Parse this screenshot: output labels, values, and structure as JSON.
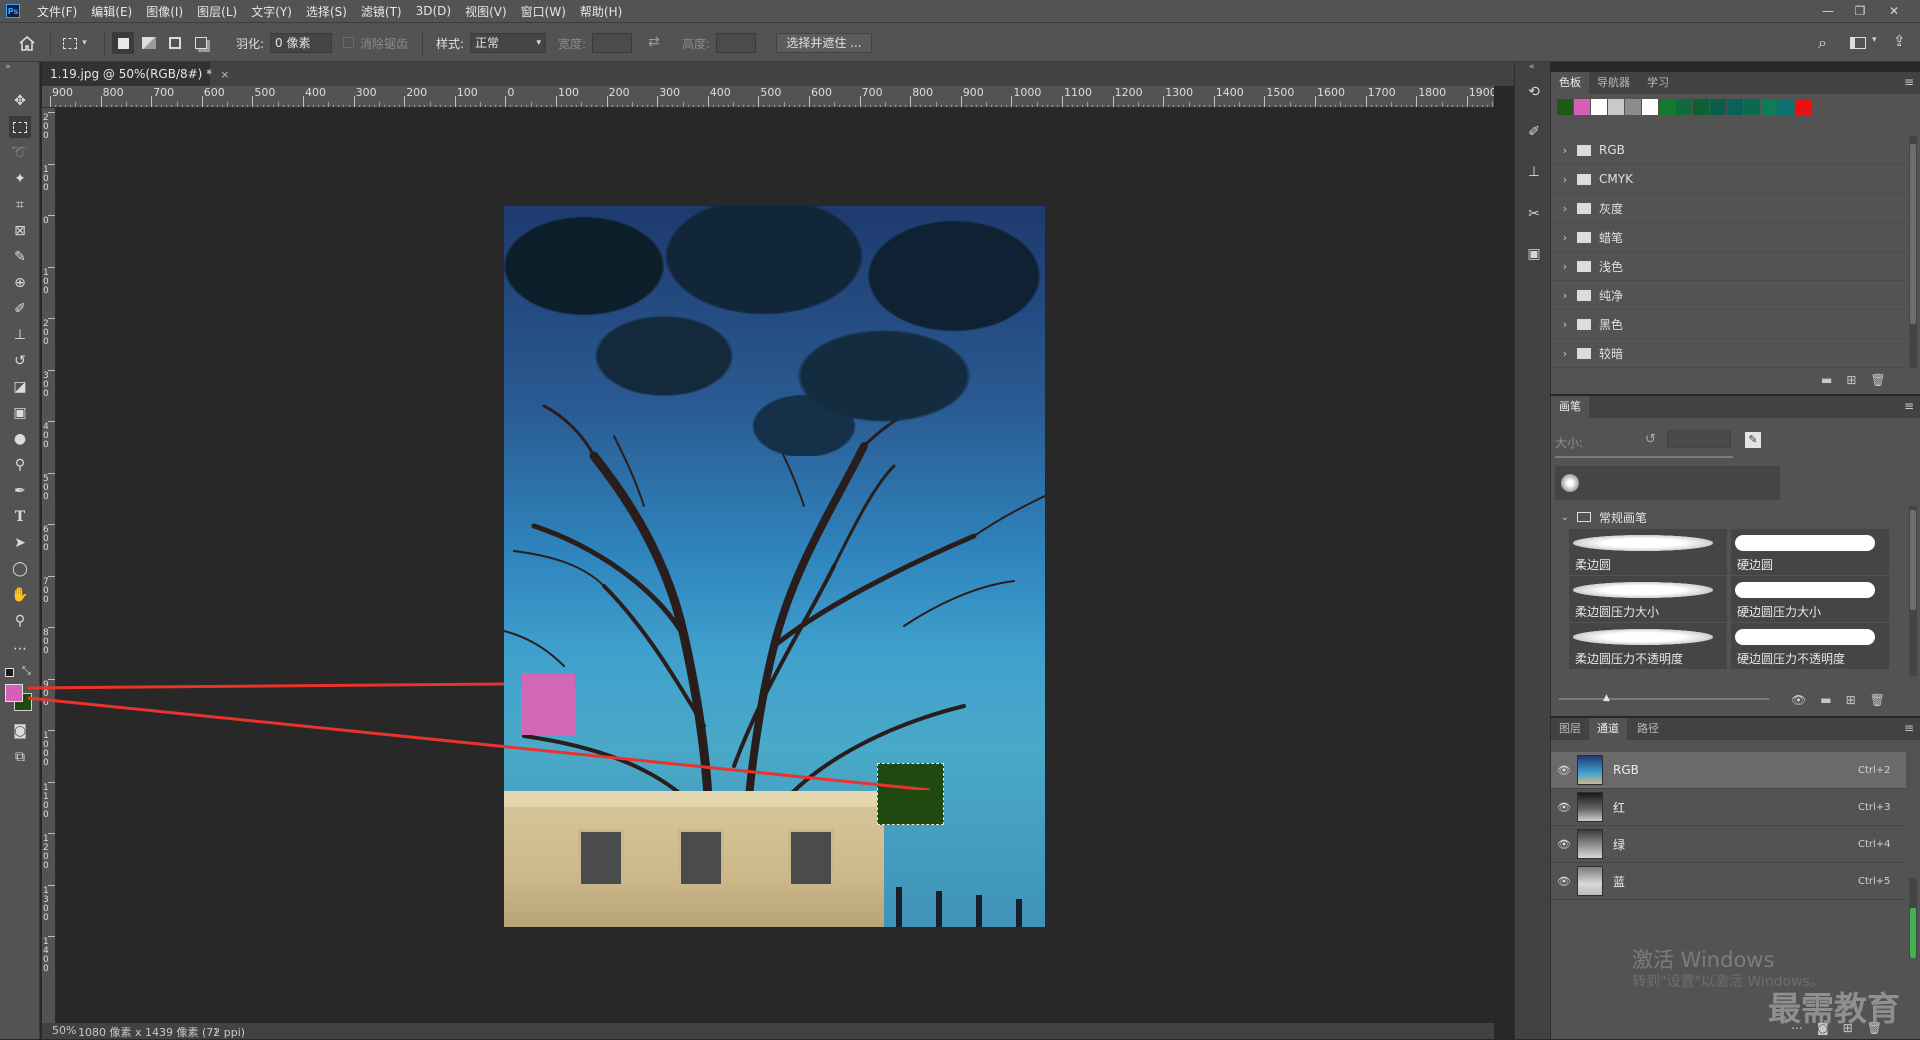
{
  "menubar": {
    "logo": "Ps",
    "items": [
      "文件(F)",
      "编辑(E)",
      "图像(I)",
      "图层(L)",
      "文字(Y)",
      "选择(S)",
      "滤镜(T)",
      "3D(D)",
      "视图(V)",
      "窗口(W)",
      "帮助(H)"
    ],
    "window_controls": [
      "—",
      "❐",
      "✕"
    ]
  },
  "options_bar": {
    "feather_label": "羽化:",
    "feather_value": "0 像素",
    "antialias_label": "消除锯齿",
    "style_label": "样式:",
    "style_value": "正常",
    "width_label": "宽度:",
    "height_label": "高度:",
    "select_mask_button": "选择并遮住 ..."
  },
  "document": {
    "tab_title": "1.19.jpg @ 50%(RGB/8#) *",
    "close_glyph": "×"
  },
  "ruler": {
    "h_labels": [
      "900",
      "800",
      "700",
      "600",
      "500",
      "400",
      "300",
      "200",
      "100",
      "0",
      "100",
      "200",
      "300",
      "400",
      "500",
      "600",
      "700",
      "800",
      "900",
      "1000",
      "1100",
      "1200",
      "1300",
      "1400",
      "1500",
      "1600",
      "1700",
      "1800",
      "1900"
    ],
    "v_labels": [
      "2\n0\n0",
      "1\n0\n0",
      "0",
      "1\n0\n0",
      "2\n0\n0",
      "3\n0\n0",
      "4\n0\n0",
      "5\n0\n0",
      "6\n0\n0",
      "7\n0\n0",
      "8\n0\n0",
      "9\n0\n0",
      "1\n0\n0\n0",
      "1\n1\n0\n0",
      "1\n2\n0\n0",
      "1\n3\n0\n0",
      "1\n4\n0\n0"
    ]
  },
  "colors": {
    "foreground": "#d560b5",
    "background": "#1e4a12",
    "pink_swatch": "#d067b7",
    "green_selection": "#1e4a12",
    "red_arrow": "#e8342c"
  },
  "swatches_panel": {
    "tabs": [
      "色板",
      "导航器",
      "学习"
    ],
    "recent": [
      "#1d5a1a",
      "#d560b5",
      "#ffffff",
      "#c9c9c9",
      "#8c8c8c",
      "#ffffff",
      "#117a2b",
      "#0f6b3a",
      "#0e5f33",
      "#0d5b4a",
      "#0c6055",
      "#0b6a4d",
      "#117a57",
      "#0f7070",
      "#e81010"
    ],
    "groups": [
      "RGB",
      "CMYK",
      "灰度",
      "蜡笔",
      "浅色",
      "纯净",
      "黑色",
      "较暗"
    ]
  },
  "brush_panel": {
    "tab": "画笔",
    "size_label": "大小:",
    "group_name": "常规画笔",
    "brushes": [
      "柔边圆",
      "硬边圆",
      "柔边圆压力大小",
      "硬边圆压力大小",
      "柔边圆压力不透明度",
      "硬边圆压力不透明度"
    ]
  },
  "channels_panel": {
    "tabs": [
      "图层",
      "通道",
      "路径"
    ],
    "channels": [
      {
        "name": "RGB",
        "shortcut": "Ctrl+2"
      },
      {
        "name": "红",
        "shortcut": "Ctrl+3"
      },
      {
        "name": "绿",
        "shortcut": "Ctrl+4"
      },
      {
        "name": "蓝",
        "shortcut": "Ctrl+5"
      }
    ]
  },
  "statusbar": {
    "zoom": "50%",
    "doc_info": "1080 像素 x 1439 像素 (72 ppi)",
    "arrow": "›"
  },
  "watermark": {
    "line1": "激活 Windows",
    "line2": "转到\"设置\"以激活 Windows。",
    "brand": "最需教育"
  }
}
